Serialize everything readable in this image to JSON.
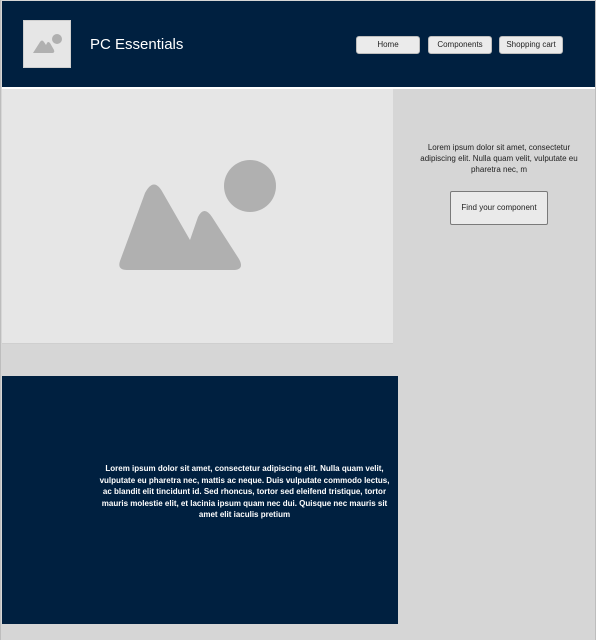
{
  "header": {
    "logo_icon": "image-placeholder-icon",
    "title": "PC Essentials",
    "nav": {
      "home": "Home",
      "components": "Components",
      "cart": "Shopping cart"
    }
  },
  "hero": {
    "image_icon": "image-placeholder-icon",
    "text": "Lorem ipsum dolor sit amet, consectetur adipiscing elit. Nulla quam velit, vulputate eu pharetra nec, m",
    "cta_label": "Find your component"
  },
  "info": {
    "text": "Lorem ipsum dolor sit amet, consectetur adipiscing elit. Nulla quam velit, vulputate eu pharetra nec, mattis ac neque. Duis vulputate commodo lectus, ac blandit elit tincidunt id. Sed rhoncus, tortor sed eleifend tristique, tortor mauris molestie elit, et lacinia ipsum quam nec dui. Quisque nec mauris sit amet elit iaculis pretium"
  },
  "colors": {
    "navy": "#002040",
    "placeholder": "#e6e6e6",
    "placeholder_icon": "#b0b0b0",
    "background": "#d6d6d6"
  }
}
